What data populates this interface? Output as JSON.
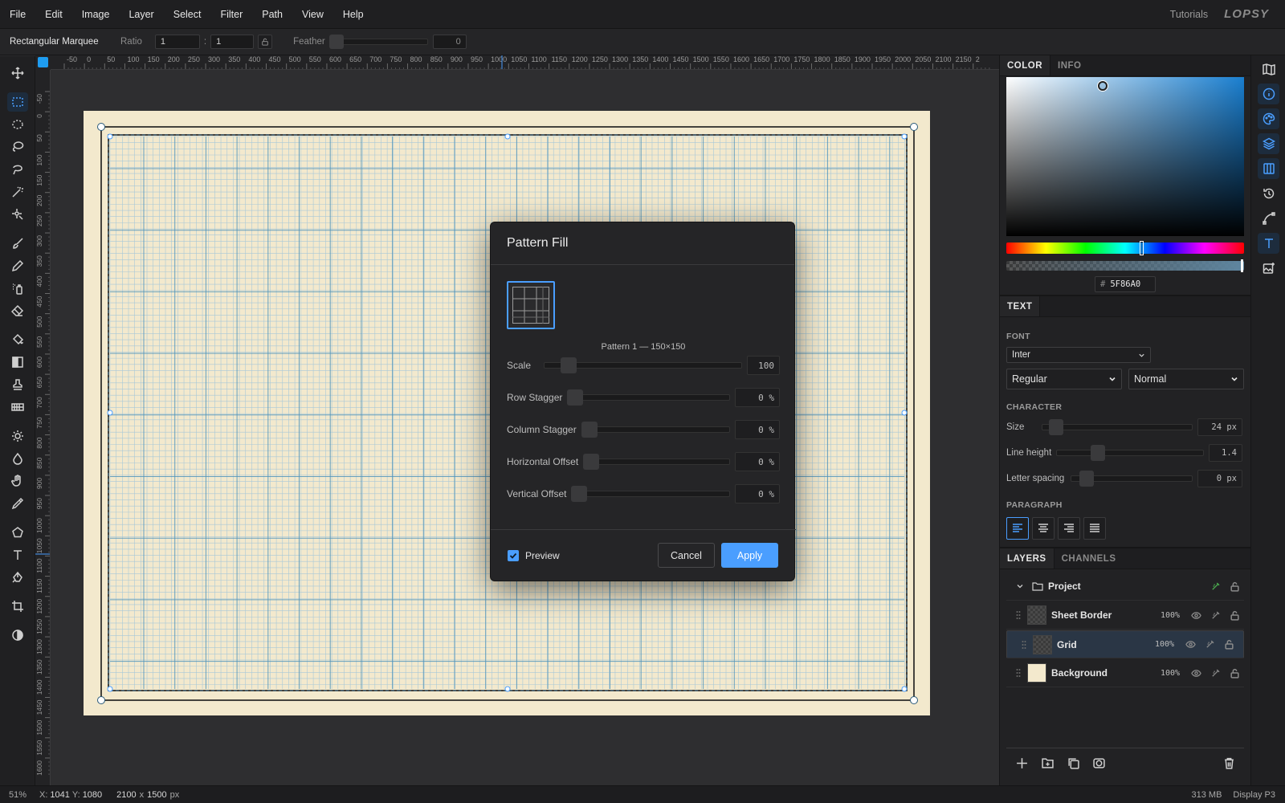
{
  "menu": {
    "items": [
      "File",
      "Edit",
      "Image",
      "Layer",
      "Select",
      "Filter",
      "Path",
      "View",
      "Help"
    ],
    "tutorials": "Tutorials",
    "logo": "LOPSY"
  },
  "options": {
    "tool_name": "Rectangular Marquee",
    "ratio_label": "Ratio",
    "ratio_w": "1",
    "ratio_sep": ":",
    "ratio_h": "1",
    "feather_label": "Feather",
    "feather_value": "0"
  },
  "rulers": {
    "top": [
      "-50",
      "0",
      "50",
      "100",
      "150",
      "200",
      "250",
      "300",
      "350",
      "400",
      "450",
      "500",
      "550",
      "600",
      "650",
      "700",
      "750",
      "800",
      "850",
      "900",
      "950",
      "1000",
      "1050",
      "1100",
      "1150",
      "1200",
      "1250",
      "1300",
      "1350",
      "1400",
      "1450",
      "1500",
      "1550",
      "1600",
      "1650",
      "1700",
      "1750",
      "1800",
      "1850",
      "1900",
      "1950",
      "2000",
      "2050",
      "2100",
      "2150",
      "2"
    ],
    "left": [
      "-50",
      "0",
      "50",
      "100",
      "150",
      "200",
      "250",
      "300",
      "350",
      "400",
      "450",
      "500",
      "550",
      "600",
      "650",
      "700",
      "750",
      "800",
      "850",
      "900",
      "950",
      "1000",
      "1050",
      "1100",
      "1150",
      "1200",
      "1250",
      "1300",
      "1350",
      "1400",
      "1450",
      "1500",
      "1550",
      "1600"
    ]
  },
  "dialog": {
    "title": "Pattern Fill",
    "pattern_caption": "Pattern 1 — 150×150",
    "scale": {
      "label": "Scale",
      "value": "100",
      "level": 0.0
    },
    "row_stagger": {
      "label": "Row Stagger",
      "value": "0 %",
      "level": 0.0
    },
    "column_stagger": {
      "label": "Column Stagger",
      "value": "0 %",
      "level": 0.0
    },
    "horizontal_offset": {
      "label": "Horizontal Offset",
      "value": "0 %",
      "level": 0.0
    },
    "vertical_offset": {
      "label": "Vertical Offset",
      "value": "0 %",
      "level": 0.0
    },
    "preview_label": "Preview",
    "preview_checked": true,
    "cancel": "Cancel",
    "apply": "Apply"
  },
  "color_panel": {
    "tab_color": "COLOR",
    "tab_info": "INFO",
    "hex_prefix": "#",
    "hex": "5F86A0",
    "base_color": "#1a7fd0"
  },
  "text_panel": {
    "tab": "TEXT",
    "font_label": "FONT",
    "font": "Inter",
    "style": "Regular",
    "variant": "Normal",
    "character_label": "CHARACTER",
    "size_label": "Size",
    "size_value": "24 px",
    "line_height_label": "Line height",
    "line_height_value": "1.4",
    "letter_spacing_label": "Letter spacing",
    "letter_spacing_value": "0 px",
    "paragraph_label": "PARAGRAPH"
  },
  "layers_panel": {
    "tab_layers": "LAYERS",
    "tab_channels": "CHANNELS",
    "group": "Project",
    "layers": [
      {
        "name": "Sheet Border",
        "opacity": "100%"
      },
      {
        "name": "Grid",
        "opacity": "100%"
      },
      {
        "name": "Background",
        "opacity": "100%"
      }
    ]
  },
  "status": {
    "zoom": "51%",
    "x_label": "X:",
    "x": "1041",
    "y_label": "Y:",
    "y": "1080",
    "doc_w": "2100",
    "doc_x": "x",
    "doc_h": "1500",
    "doc_unit": "px",
    "memory": "313 MB",
    "display": "Display P3"
  },
  "colors": {
    "accent": "#4a9eff",
    "paper": "#f3e9cd",
    "grid_minor": "#a7c8d8",
    "grid_major": "#4f94bc"
  }
}
